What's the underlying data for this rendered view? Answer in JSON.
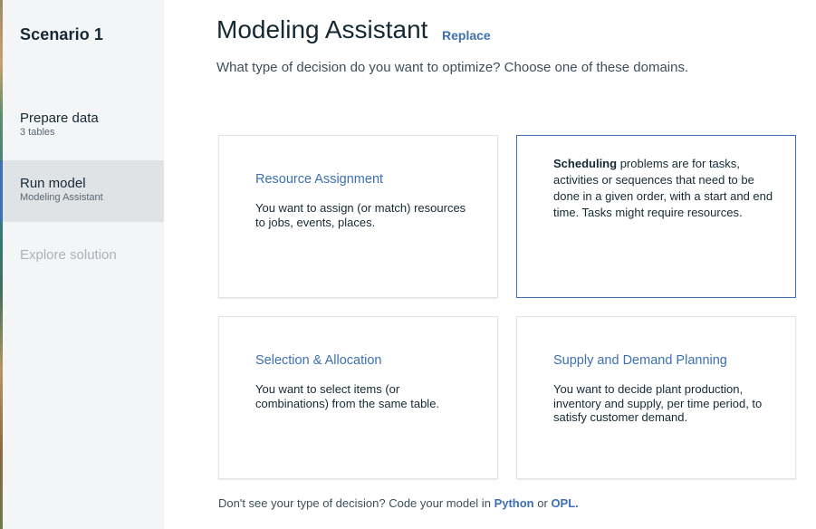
{
  "sidebar": {
    "scenario_title": "Scenario 1",
    "items": [
      {
        "label": "Prepare data",
        "sub": "3 tables"
      },
      {
        "label": "Run model",
        "sub": "Modeling Assistant"
      },
      {
        "label": "Explore solution"
      }
    ]
  },
  "main": {
    "title": "Modeling Assistant",
    "replace_label": "Replace",
    "subtitle": "What type of decision do you want to optimize? Choose one of these domains.",
    "cards": [
      {
        "title": "Resource Assignment",
        "description": "You want to assign (or match) resources to jobs, events, places."
      },
      {
        "title_bold": "Scheduling",
        "description": "problems are for tasks, activities or sequences that need to be done in a given order, with a start and end time. Tasks might require resources."
      },
      {
        "title": "Selection & Allocation",
        "description": "You want to select items (or combinations) from the same table."
      },
      {
        "title": "Supply and Demand Planning",
        "description": "You want to decide plant production, inventory and supply, per time period, to satisfy customer demand."
      }
    ],
    "footer": {
      "prefix": "Don't see your type of decision? Code your model in",
      "python": "Python",
      "or": "or",
      "opl": "OPL."
    }
  },
  "colors": {
    "accent": "#3d70b2",
    "sidebar_bg": "#f4f5f7",
    "active_bg": "#dfe3e6",
    "text": "#152935",
    "muted": "#a9b3bb"
  }
}
